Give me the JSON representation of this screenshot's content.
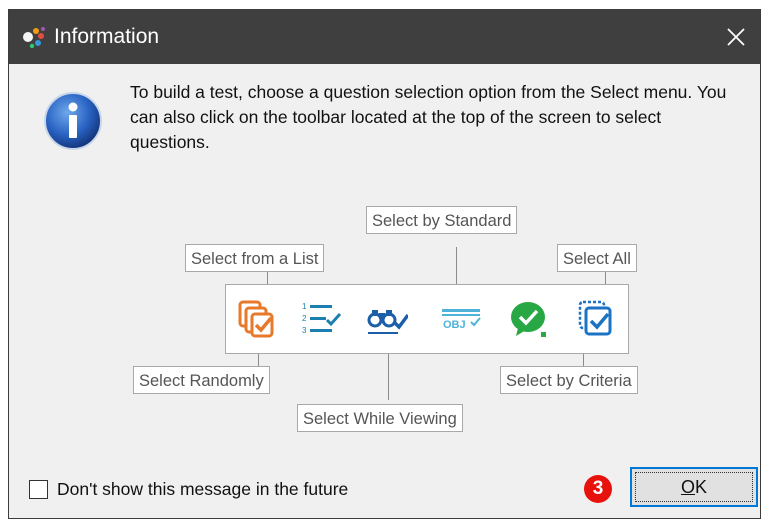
{
  "window": {
    "title": "Information",
    "close_icon": "close-icon",
    "app_icon": "app-logo-icon"
  },
  "message": {
    "icon": "info-icon",
    "text": "To build a test, choose a question selection option from the Select menu.  You can also click on the toolbar located at the top of the screen to select questions."
  },
  "callouts": {
    "select_from_list": "Select from a List",
    "select_by_standard": "Select by Standard",
    "select_all": "Select All",
    "select_randomly": "Select Randomly",
    "select_while_viewing": "Select While Viewing",
    "select_by_criteria": "Select by Criteria"
  },
  "toolbar": {
    "icons": [
      {
        "name": "select-randomly-icon",
        "color": "#e8792b"
      },
      {
        "name": "select-from-list-icon",
        "color": "#1b7fb0"
      },
      {
        "name": "select-while-viewing-icon",
        "color": "#1b5fa8"
      },
      {
        "name": "select-by-standard-icon",
        "color": "#4fb3d9",
        "text": "OBJ"
      },
      {
        "name": "select-by-criteria-icon",
        "color": "#27a844"
      },
      {
        "name": "select-all-icon",
        "color": "#1b73c4"
      }
    ]
  },
  "footer": {
    "checkbox_label": "Don't show this message in the future",
    "checkbox_checked": false,
    "step_badge": "3",
    "ok_mnemonic": "O",
    "ok_rest": "K"
  },
  "colors": {
    "titlebar": "#3f3f3f",
    "dialog_bg": "#f0f0f0",
    "accent": "#0078d7",
    "badge": "#e8120c"
  }
}
